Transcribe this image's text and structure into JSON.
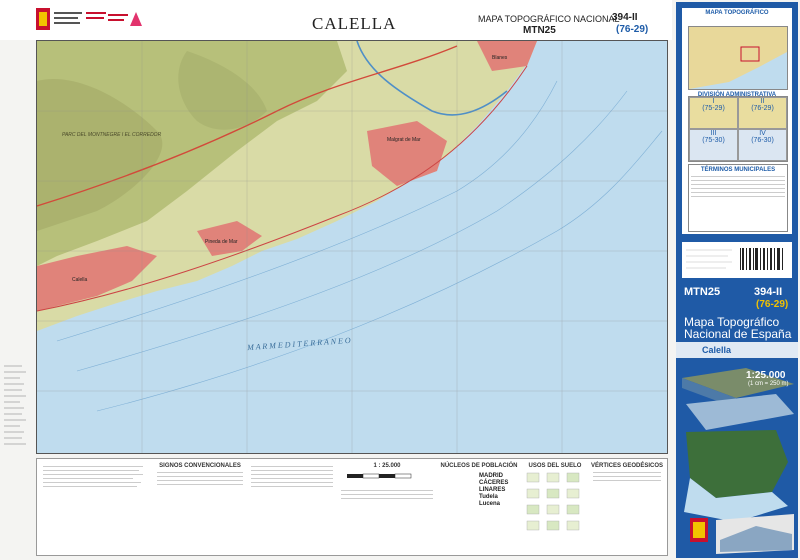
{
  "header": {
    "map_title": "CALELLA",
    "series_title": "MAPA TOPOGRÁFICO NACIONAL",
    "series_code": "MTN25",
    "sheet_number": "394-II",
    "sheet_alt": "(76-29)"
  },
  "map": {
    "sea_label": "M A R   M E D I T E R R A N E O",
    "places": [
      "Calella",
      "Malgrat de Mar",
      "Pineda de Mar",
      "Blanes",
      "PARC DEL MONTNEGRE I EL CORREDOR"
    ],
    "colors": {
      "sea": "#bfdcee",
      "land": "#d9dba6",
      "forest": "#b7c07a",
      "urban": "#e0837a"
    }
  },
  "legend": {
    "signs_title": "SIGNOS CONVENCIONALES",
    "scale_title": "1 : 25.000",
    "population_title": "NÚCLEOS DE POBLACIÓN",
    "population_examples": [
      "MADRID",
      "CÁCERES",
      "LINARES",
      "Tudela",
      "Lucena"
    ],
    "land_use_title": "USOS DEL SUELO",
    "geodetic_title": "VÉRTICES GEODÉSICOS"
  },
  "cover": {
    "index_title": "MAPA TOPOGRÁFICO",
    "admin_title": "DIVISIÓN ADMINISTRATIVA",
    "admin_quadrants": [
      {
        "roman": "I",
        "label": "(75-29)"
      },
      {
        "roman": "II",
        "label": "(76-29)"
      },
      {
        "roman": "III",
        "label": "(75-30)"
      },
      {
        "roman": "IV",
        "label": "(76-30)"
      }
    ],
    "municipal_title": "TÉRMINOS MUNICIPALES",
    "series_code": "MTN25",
    "sheet_number": "394-II",
    "sheet_alt": "(76-29)",
    "series_name": "Mapa Topográfico Nacional de España",
    "sheet_name": "Calella",
    "scale": "1:25.000",
    "scale_note": "(1 cm = 250 m)"
  }
}
